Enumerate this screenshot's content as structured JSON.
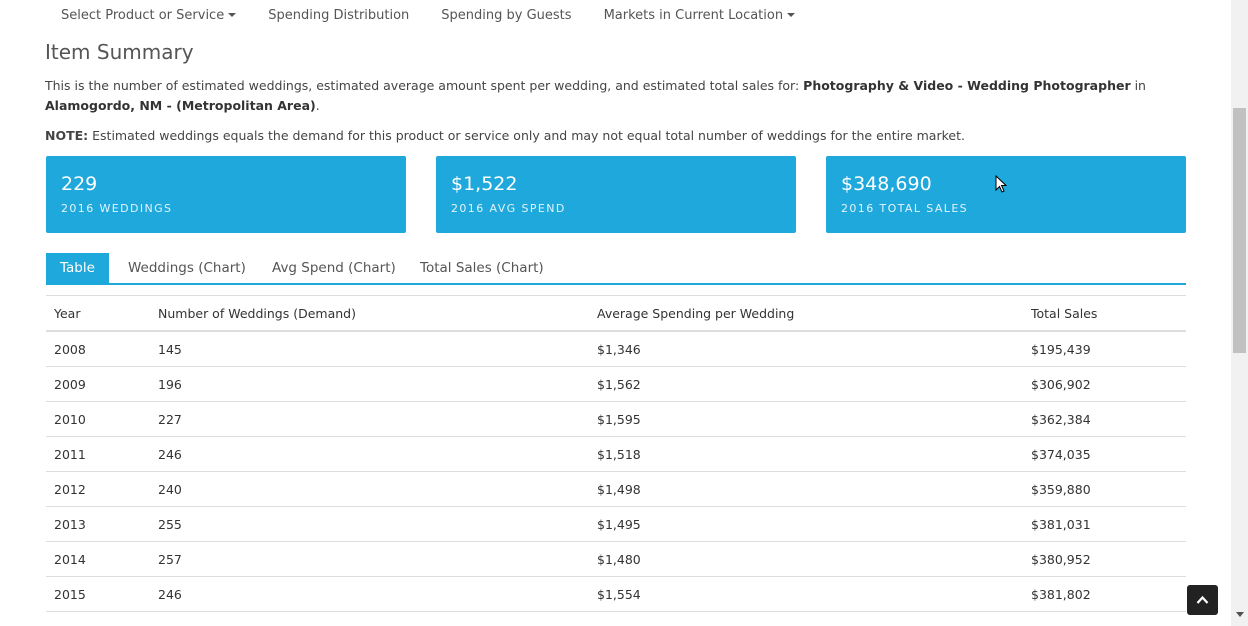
{
  "nav": {
    "select_product": "Select Product or Service",
    "spending_distribution": "Spending Distribution",
    "spending_guests": "Spending by Guests",
    "markets": "Markets in Current Location"
  },
  "summary": {
    "title": "Item Summary",
    "desc_pre": "This is the number of estimated weddings, estimated average amount spent per wedding, and estimated total sales for: ",
    "product": "Photography & Video - Wedding Photographer",
    "desc_in": " in ",
    "location": "Alamogordo, NM - (Metropolitan Area)",
    "desc_end": ".",
    "note_label": "NOTE:",
    "note_text": " Estimated weddings equals the demand for this product or service only and may not equal total number of weddings for the entire market."
  },
  "stats": [
    {
      "value": "229",
      "label": "2016 WEDDINGS"
    },
    {
      "value": "$1,522",
      "label": "2016 AVG SPEND"
    },
    {
      "value": "$348,690",
      "label": "2016 TOTAL SALES"
    }
  ],
  "tabs": [
    "Table",
    "Weddings (Chart)",
    "Avg Spend (Chart)",
    "Total Sales (Chart)"
  ],
  "table": {
    "headers": [
      "Year",
      "Number of Weddings (Demand)",
      "Average Spending per Wedding",
      "Total Sales"
    ],
    "rows": [
      [
        "2008",
        "145",
        "$1,346",
        "$195,439"
      ],
      [
        "2009",
        "196",
        "$1,562",
        "$306,902"
      ],
      [
        "2010",
        "227",
        "$1,595",
        "$362,384"
      ],
      [
        "2011",
        "246",
        "$1,518",
        "$374,035"
      ],
      [
        "2012",
        "240",
        "$1,498",
        "$359,880"
      ],
      [
        "2013",
        "255",
        "$1,495",
        "$381,031"
      ],
      [
        "2014",
        "257",
        "$1,480",
        "$380,952"
      ],
      [
        "2015",
        "246",
        "$1,554",
        "$381,802"
      ]
    ]
  },
  "colors": {
    "accent": "#1fa8dc",
    "text": "#333333"
  },
  "icons": {
    "scroll_top": "chevron-up-icon",
    "cursor": "mouse-pointer-icon"
  }
}
